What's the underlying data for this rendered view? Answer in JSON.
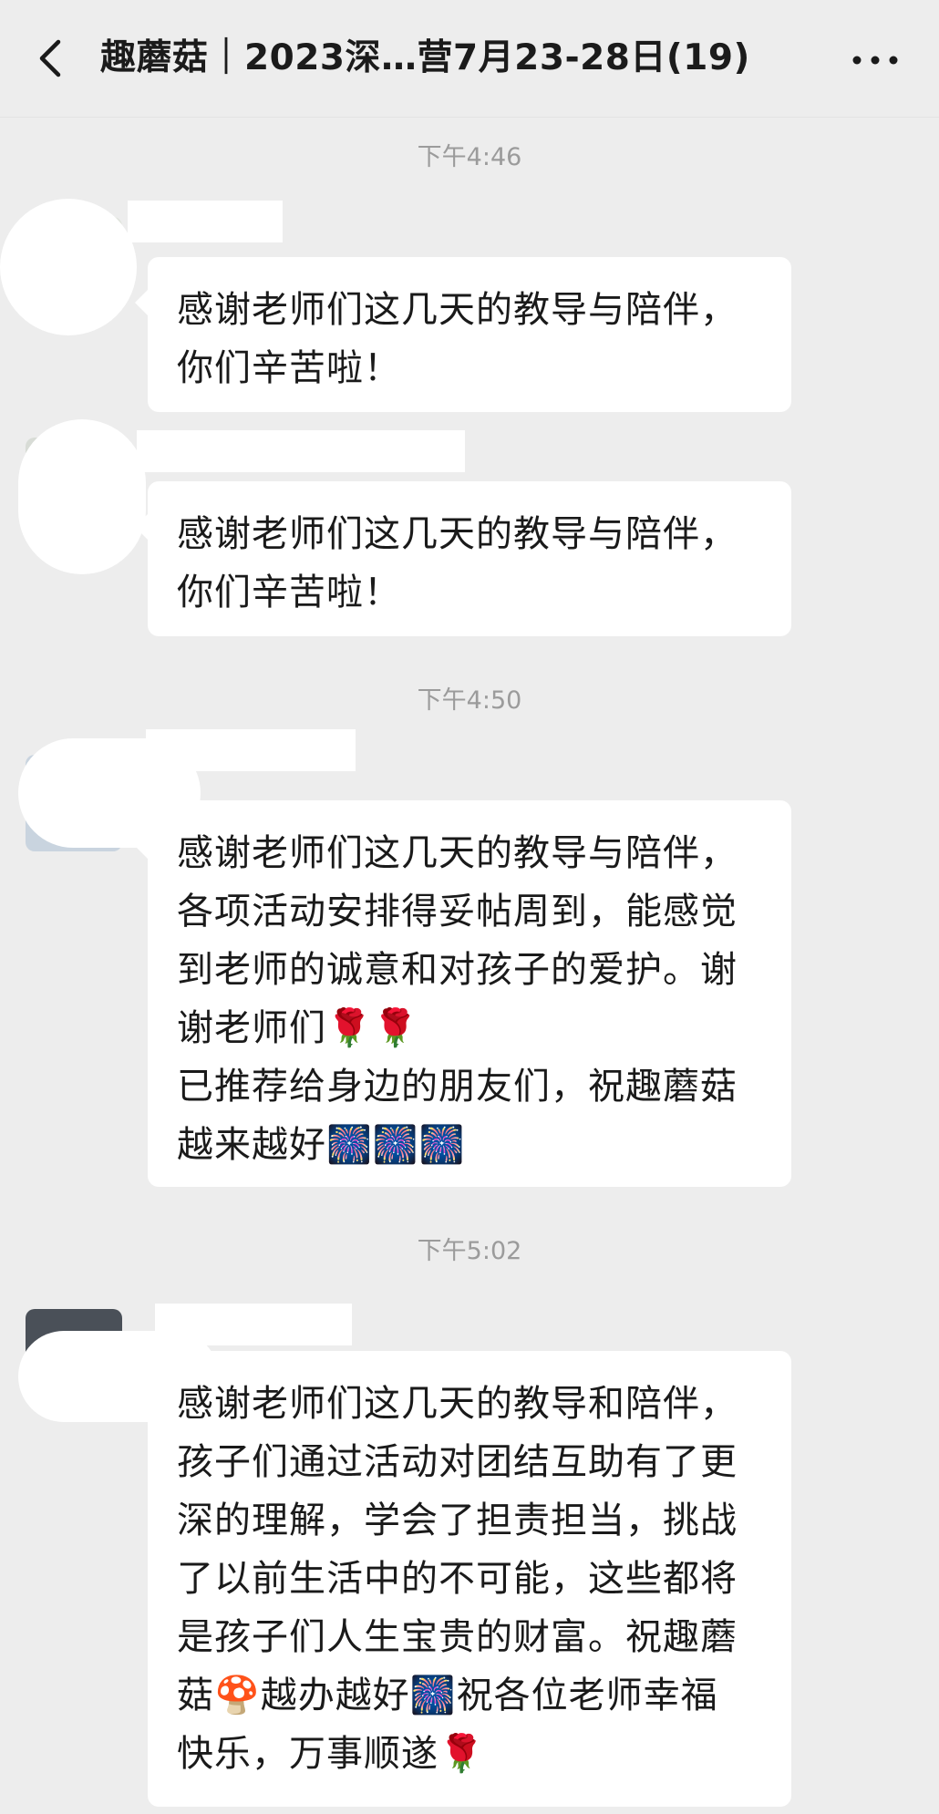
{
  "header": {
    "title": "趣蘑菇｜2023深…营7月23-28日(19)",
    "back_icon": "chevron-left-icon",
    "more_icon": "more-dots-icon"
  },
  "timestamps": [
    "下午4:46",
    "下午4:50",
    "下午5:02"
  ],
  "messages": [
    {
      "lines": [
        "感谢老师们这几天的教导与陪伴，",
        "你们辛苦啦！"
      ]
    },
    {
      "lines": [
        "感谢老师们这几天的教导与陪伴，",
        "你们辛苦啦！"
      ]
    },
    {
      "lines": [
        "感谢老师们这几天的教导与陪伴，",
        "各项活动安排得妥帖周到，能感觉",
        "到老师的诚意和对孩子的爱护。谢",
        "谢老师们🌹🌹",
        "已推荐给身边的朋友们，祝趣蘑菇",
        "越来越好🎆🎆🎆"
      ]
    },
    {
      "lines": [
        "感谢老师们这几天的教导和陪伴，",
        "孩子们通过活动对团结互助有了更",
        "深的理解，学会了担责担当，挑战",
        "了以前生活中的不可能，这些都将",
        "是孩子们人生宝贵的财富。祝趣蘑",
        "菇🍄越办越好🎆祝各位老师幸福",
        "快乐，万事顺遂🌹"
      ]
    }
  ]
}
